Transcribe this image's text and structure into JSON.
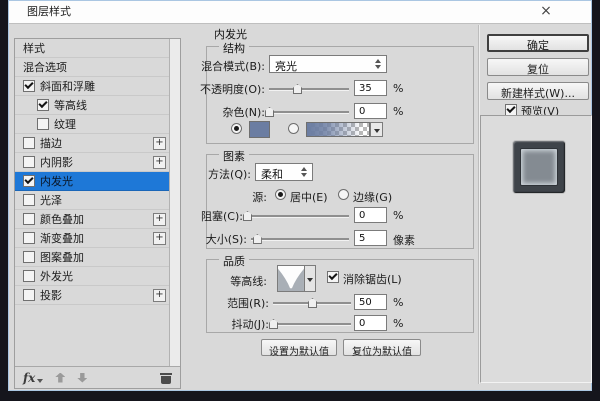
{
  "window": {
    "title": "图层样式",
    "close_icon": "×"
  },
  "sidebar": {
    "items": [
      {
        "key": "styles",
        "label": "样式",
        "checkbox": false,
        "checked": false,
        "plus": false,
        "selected": false,
        "indent": false
      },
      {
        "key": "blending-options",
        "label": "混合选项",
        "checkbox": false,
        "checked": false,
        "plus": false,
        "selected": false,
        "indent": false
      },
      {
        "key": "bevel-emboss",
        "label": "斜面和浮雕",
        "checkbox": true,
        "checked": true,
        "plus": false,
        "selected": false,
        "indent": false
      },
      {
        "key": "contour",
        "label": "等高线",
        "checkbox": true,
        "checked": true,
        "plus": false,
        "selected": false,
        "indent": true
      },
      {
        "key": "texture",
        "label": "纹理",
        "checkbox": true,
        "checked": false,
        "plus": false,
        "selected": false,
        "indent": true
      },
      {
        "key": "stroke",
        "label": "描边",
        "checkbox": true,
        "checked": false,
        "plus": true,
        "selected": false,
        "indent": false
      },
      {
        "key": "inner-shadow",
        "label": "内阴影",
        "checkbox": true,
        "checked": false,
        "plus": true,
        "selected": false,
        "indent": false
      },
      {
        "key": "inner-glow",
        "label": "内发光",
        "checkbox": true,
        "checked": true,
        "plus": false,
        "selected": true,
        "indent": false
      },
      {
        "key": "satin",
        "label": "光泽",
        "checkbox": true,
        "checked": false,
        "plus": false,
        "selected": false,
        "indent": false
      },
      {
        "key": "color-overlay",
        "label": "颜色叠加",
        "checkbox": true,
        "checked": false,
        "plus": true,
        "selected": false,
        "indent": false
      },
      {
        "key": "gradient-overlay",
        "label": "渐变叠加",
        "checkbox": true,
        "checked": false,
        "plus": true,
        "selected": false,
        "indent": false
      },
      {
        "key": "pattern-overlay",
        "label": "图案叠加",
        "checkbox": true,
        "checked": false,
        "plus": false,
        "selected": false,
        "indent": false
      },
      {
        "key": "outer-glow",
        "label": "外发光",
        "checkbox": true,
        "checked": false,
        "plus": false,
        "selected": false,
        "indent": false
      },
      {
        "key": "drop-shadow",
        "label": "投影",
        "checkbox": true,
        "checked": false,
        "plus": true,
        "selected": false,
        "indent": false
      }
    ],
    "footer": {
      "fx_label": "fx",
      "plus_icon": "+"
    }
  },
  "panel": {
    "title": "内发光",
    "structure": {
      "group_label": "结构",
      "blend_mode_label": "混合模式(B):",
      "blend_mode_value": "亮光",
      "opacity_label": "不透明度(O):",
      "opacity_value": "35",
      "opacity_unit": "%",
      "noise_label": "杂色(N):",
      "noise_value": "0",
      "noise_unit": "%"
    },
    "elements": {
      "group_label": "图素",
      "technique_label": "方法(Q):",
      "technique_value": "柔和",
      "source_label": "源:",
      "source_center_label": "居中(E)",
      "source_edge_label": "边缘(G)",
      "choke_label": "阻塞(C):",
      "choke_value": "0",
      "choke_unit": "%",
      "size_label": "大小(S):",
      "size_value": "5",
      "size_unit": "像素"
    },
    "quality": {
      "group_label": "品质",
      "contour_label": "等高线:",
      "antialias_label": "消除锯齿(L)",
      "range_label": "范围(R):",
      "range_value": "50",
      "range_unit": "%",
      "jitter_label": "抖动(J):",
      "jitter_value": "0",
      "jitter_unit": "%"
    },
    "sliders": {
      "opacity": 35,
      "noise": 0,
      "choke": 0,
      "size": 6,
      "range": 50,
      "jitter": 0
    },
    "footer_buttons": {
      "make_default": "设置为默认值",
      "reset_default": "复位为默认值"
    }
  },
  "right": {
    "ok": "确定",
    "reset": "复位",
    "new_style": "新建样式(W)...",
    "preview_label": "预览(V)",
    "preview_checked": true
  },
  "colors": {
    "accent_blue": "#1e78d7",
    "glow_color": "#6b7da2",
    "dialog_bg": "#d9d9d9"
  }
}
